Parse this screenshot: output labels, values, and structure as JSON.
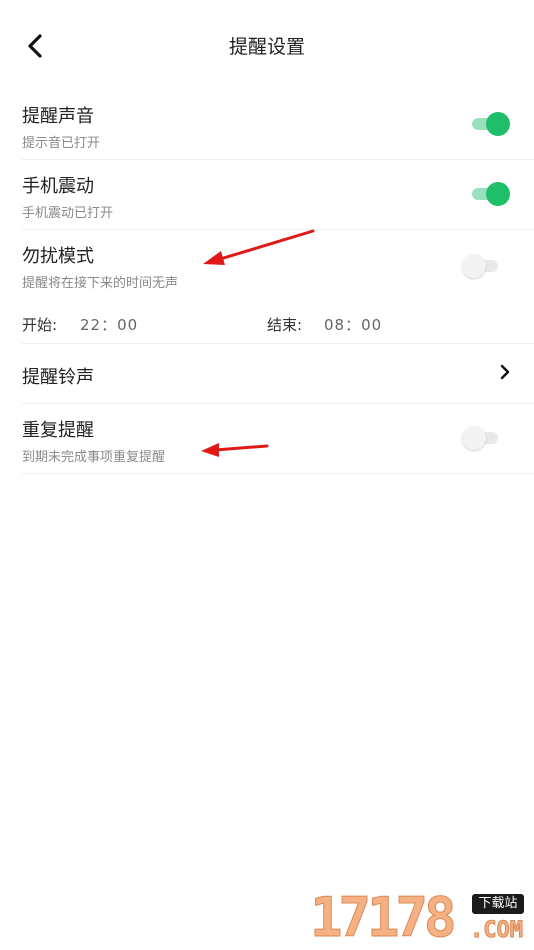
{
  "header": {
    "title": "提醒设置",
    "back_icon": "chevron-left-icon"
  },
  "settings": {
    "sound": {
      "title": "提醒声音",
      "subtitle": "提示音已打开",
      "enabled": true
    },
    "vibrate": {
      "title": "手机震动",
      "subtitle": "手机震动已打开",
      "enabled": true
    },
    "dnd": {
      "title": "勿扰模式",
      "subtitle": "提醒将在接下来的时间无声",
      "enabled": false,
      "start_label": "开始:",
      "start_time": "22：00",
      "end_label": "结束:",
      "end_time": "08：00"
    },
    "ringtone": {
      "title": "提醒铃声",
      "chevron_icon": "chevron-right-icon"
    },
    "repeat": {
      "title": "重复提醒",
      "subtitle": "到期未完成事项重复提醒",
      "enabled": false
    }
  },
  "colors": {
    "toggle_on": "#1fbf6a",
    "toggle_on_track": "#9be0bd",
    "toggle_off": "#f3f3f3",
    "annotation_arrow": "#e01818"
  },
  "watermark": {
    "number": "17178",
    "badge": "下载站",
    "suffix": ".COM"
  }
}
